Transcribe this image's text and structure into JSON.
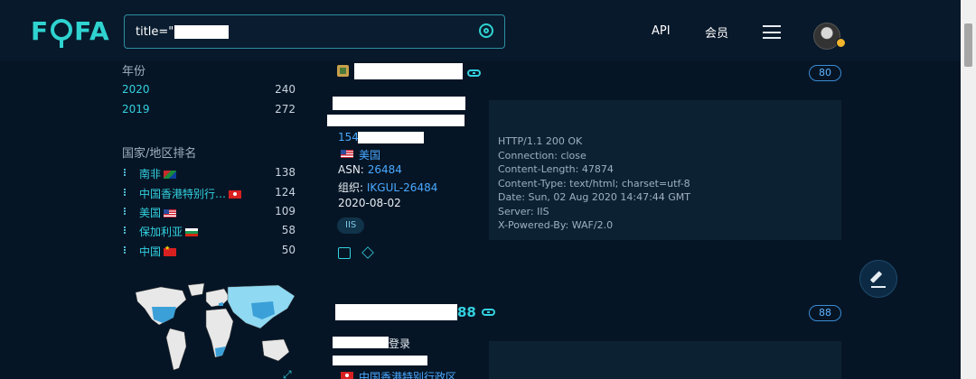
{
  "header": {
    "logo": "FOFA",
    "search_value": "title=\"",
    "nav_api": "API",
    "nav_vip": "会员"
  },
  "sidebar": {
    "year_title": "年份",
    "years": [
      {
        "label": "2020",
        "count": "240"
      },
      {
        "label": "2019",
        "count": "272"
      }
    ],
    "country_title": "国家/地区排名",
    "countries": [
      {
        "label": "南非",
        "flag": "za",
        "count": "138"
      },
      {
        "label": "中国香港特别行…",
        "flag": "hk",
        "count": "124"
      },
      {
        "label": "美国",
        "flag": "us",
        "count": "109"
      },
      {
        "label": "保加利亚",
        "flag": "bg",
        "count": "58"
      },
      {
        "label": "中国",
        "flag": "cn",
        "count": "50"
      }
    ]
  },
  "results": [
    {
      "port": "80",
      "ip_prefix": "154",
      "location": "美国",
      "asn_label": "ASN:",
      "asn": "26484",
      "org_label": "组织:",
      "org": "IKGUL-26484",
      "date": "2020-08-02",
      "tag": "IIS",
      "http_lines": [
        "HTTP/1.1 200 OK",
        "Connection: close",
        "Content-Length: 47874",
        "Content-Type: text/html; charset=utf-8",
        "Date: Sun, 02 Aug 2020 14:47:44 GMT",
        "Server: IIS",
        "X-Powered-By: WAF/2.0"
      ]
    },
    {
      "port": "88",
      "title_suffix": "88",
      "login_text": "登录",
      "location": "中国香港特别行政区"
    }
  ],
  "colors": {
    "accent": "#2fd3d0",
    "link": "#4aa8ff",
    "background": "#061525"
  }
}
